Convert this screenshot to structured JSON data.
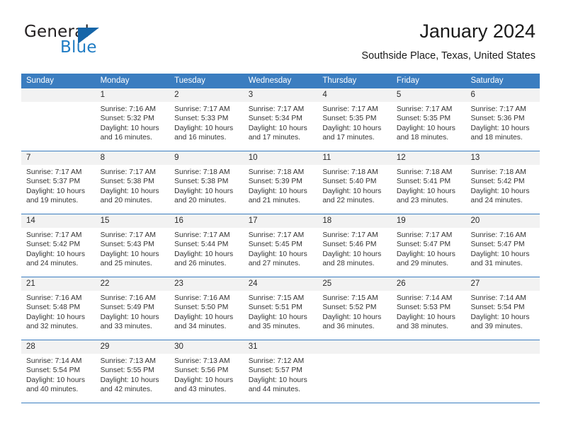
{
  "logo": {
    "word_one": "General",
    "word_two": "Blue",
    "triangle_icon": "triangle-icon",
    "brand_dark": "#231f20",
    "brand_blue": "#1f7cc4"
  },
  "header": {
    "title": "January 2024",
    "subtitle": "Southside Place, Texas, United States"
  },
  "colors": {
    "header_blue": "#3b7dc0",
    "day_band_gray": "#f2f2f2",
    "text": "#333333"
  },
  "weekday_headers": [
    "Sunday",
    "Monday",
    "Tuesday",
    "Wednesday",
    "Thursday",
    "Friday",
    "Saturday"
  ],
  "labels": {
    "sunrise_prefix": "Sunrise:",
    "sunset_prefix": "Sunset:",
    "daylight_prefix": "Daylight:"
  },
  "weeks": [
    [
      {
        "day": "",
        "sunrise": "",
        "sunset": "",
        "daylight_line1": "",
        "daylight_line2": ""
      },
      {
        "day": "1",
        "sunrise": "Sunrise: 7:16 AM",
        "sunset": "Sunset: 5:32 PM",
        "daylight_line1": "Daylight: 10 hours",
        "daylight_line2": "and 16 minutes."
      },
      {
        "day": "2",
        "sunrise": "Sunrise: 7:17 AM",
        "sunset": "Sunset: 5:33 PM",
        "daylight_line1": "Daylight: 10 hours",
        "daylight_line2": "and 16 minutes."
      },
      {
        "day": "3",
        "sunrise": "Sunrise: 7:17 AM",
        "sunset": "Sunset: 5:34 PM",
        "daylight_line1": "Daylight: 10 hours",
        "daylight_line2": "and 17 minutes."
      },
      {
        "day": "4",
        "sunrise": "Sunrise: 7:17 AM",
        "sunset": "Sunset: 5:35 PM",
        "daylight_line1": "Daylight: 10 hours",
        "daylight_line2": "and 17 minutes."
      },
      {
        "day": "5",
        "sunrise": "Sunrise: 7:17 AM",
        "sunset": "Sunset: 5:35 PM",
        "daylight_line1": "Daylight: 10 hours",
        "daylight_line2": "and 18 minutes."
      },
      {
        "day": "6",
        "sunrise": "Sunrise: 7:17 AM",
        "sunset": "Sunset: 5:36 PM",
        "daylight_line1": "Daylight: 10 hours",
        "daylight_line2": "and 18 minutes."
      }
    ],
    [
      {
        "day": "7",
        "sunrise": "Sunrise: 7:17 AM",
        "sunset": "Sunset: 5:37 PM",
        "daylight_line1": "Daylight: 10 hours",
        "daylight_line2": "and 19 minutes."
      },
      {
        "day": "8",
        "sunrise": "Sunrise: 7:17 AM",
        "sunset": "Sunset: 5:38 PM",
        "daylight_line1": "Daylight: 10 hours",
        "daylight_line2": "and 20 minutes."
      },
      {
        "day": "9",
        "sunrise": "Sunrise: 7:18 AM",
        "sunset": "Sunset: 5:38 PM",
        "daylight_line1": "Daylight: 10 hours",
        "daylight_line2": "and 20 minutes."
      },
      {
        "day": "10",
        "sunrise": "Sunrise: 7:18 AM",
        "sunset": "Sunset: 5:39 PM",
        "daylight_line1": "Daylight: 10 hours",
        "daylight_line2": "and 21 minutes."
      },
      {
        "day": "11",
        "sunrise": "Sunrise: 7:18 AM",
        "sunset": "Sunset: 5:40 PM",
        "daylight_line1": "Daylight: 10 hours",
        "daylight_line2": "and 22 minutes."
      },
      {
        "day": "12",
        "sunrise": "Sunrise: 7:18 AM",
        "sunset": "Sunset: 5:41 PM",
        "daylight_line1": "Daylight: 10 hours",
        "daylight_line2": "and 23 minutes."
      },
      {
        "day": "13",
        "sunrise": "Sunrise: 7:18 AM",
        "sunset": "Sunset: 5:42 PM",
        "daylight_line1": "Daylight: 10 hours",
        "daylight_line2": "and 24 minutes."
      }
    ],
    [
      {
        "day": "14",
        "sunrise": "Sunrise: 7:17 AM",
        "sunset": "Sunset: 5:42 PM",
        "daylight_line1": "Daylight: 10 hours",
        "daylight_line2": "and 24 minutes."
      },
      {
        "day": "15",
        "sunrise": "Sunrise: 7:17 AM",
        "sunset": "Sunset: 5:43 PM",
        "daylight_line1": "Daylight: 10 hours",
        "daylight_line2": "and 25 minutes."
      },
      {
        "day": "16",
        "sunrise": "Sunrise: 7:17 AM",
        "sunset": "Sunset: 5:44 PM",
        "daylight_line1": "Daylight: 10 hours",
        "daylight_line2": "and 26 minutes."
      },
      {
        "day": "17",
        "sunrise": "Sunrise: 7:17 AM",
        "sunset": "Sunset: 5:45 PM",
        "daylight_line1": "Daylight: 10 hours",
        "daylight_line2": "and 27 minutes."
      },
      {
        "day": "18",
        "sunrise": "Sunrise: 7:17 AM",
        "sunset": "Sunset: 5:46 PM",
        "daylight_line1": "Daylight: 10 hours",
        "daylight_line2": "and 28 minutes."
      },
      {
        "day": "19",
        "sunrise": "Sunrise: 7:17 AM",
        "sunset": "Sunset: 5:47 PM",
        "daylight_line1": "Daylight: 10 hours",
        "daylight_line2": "and 29 minutes."
      },
      {
        "day": "20",
        "sunrise": "Sunrise: 7:16 AM",
        "sunset": "Sunset: 5:47 PM",
        "daylight_line1": "Daylight: 10 hours",
        "daylight_line2": "and 31 minutes."
      }
    ],
    [
      {
        "day": "21",
        "sunrise": "Sunrise: 7:16 AM",
        "sunset": "Sunset: 5:48 PM",
        "daylight_line1": "Daylight: 10 hours",
        "daylight_line2": "and 32 minutes."
      },
      {
        "day": "22",
        "sunrise": "Sunrise: 7:16 AM",
        "sunset": "Sunset: 5:49 PM",
        "daylight_line1": "Daylight: 10 hours",
        "daylight_line2": "and 33 minutes."
      },
      {
        "day": "23",
        "sunrise": "Sunrise: 7:16 AM",
        "sunset": "Sunset: 5:50 PM",
        "daylight_line1": "Daylight: 10 hours",
        "daylight_line2": "and 34 minutes."
      },
      {
        "day": "24",
        "sunrise": "Sunrise: 7:15 AM",
        "sunset": "Sunset: 5:51 PM",
        "daylight_line1": "Daylight: 10 hours",
        "daylight_line2": "and 35 minutes."
      },
      {
        "day": "25",
        "sunrise": "Sunrise: 7:15 AM",
        "sunset": "Sunset: 5:52 PM",
        "daylight_line1": "Daylight: 10 hours",
        "daylight_line2": "and 36 minutes."
      },
      {
        "day": "26",
        "sunrise": "Sunrise: 7:14 AM",
        "sunset": "Sunset: 5:53 PM",
        "daylight_line1": "Daylight: 10 hours",
        "daylight_line2": "and 38 minutes."
      },
      {
        "day": "27",
        "sunrise": "Sunrise: 7:14 AM",
        "sunset": "Sunset: 5:54 PM",
        "daylight_line1": "Daylight: 10 hours",
        "daylight_line2": "and 39 minutes."
      }
    ],
    [
      {
        "day": "28",
        "sunrise": "Sunrise: 7:14 AM",
        "sunset": "Sunset: 5:54 PM",
        "daylight_line1": "Daylight: 10 hours",
        "daylight_line2": "and 40 minutes."
      },
      {
        "day": "29",
        "sunrise": "Sunrise: 7:13 AM",
        "sunset": "Sunset: 5:55 PM",
        "daylight_line1": "Daylight: 10 hours",
        "daylight_line2": "and 42 minutes."
      },
      {
        "day": "30",
        "sunrise": "Sunrise: 7:13 AM",
        "sunset": "Sunset: 5:56 PM",
        "daylight_line1": "Daylight: 10 hours",
        "daylight_line2": "and 43 minutes."
      },
      {
        "day": "31",
        "sunrise": "Sunrise: 7:12 AM",
        "sunset": "Sunset: 5:57 PM",
        "daylight_line1": "Daylight: 10 hours",
        "daylight_line2": "and 44 minutes."
      },
      {
        "day": "",
        "sunrise": "",
        "sunset": "",
        "daylight_line1": "",
        "daylight_line2": ""
      },
      {
        "day": "",
        "sunrise": "",
        "sunset": "",
        "daylight_line1": "",
        "daylight_line2": ""
      },
      {
        "day": "",
        "sunrise": "",
        "sunset": "",
        "daylight_line1": "",
        "daylight_line2": ""
      }
    ]
  ]
}
